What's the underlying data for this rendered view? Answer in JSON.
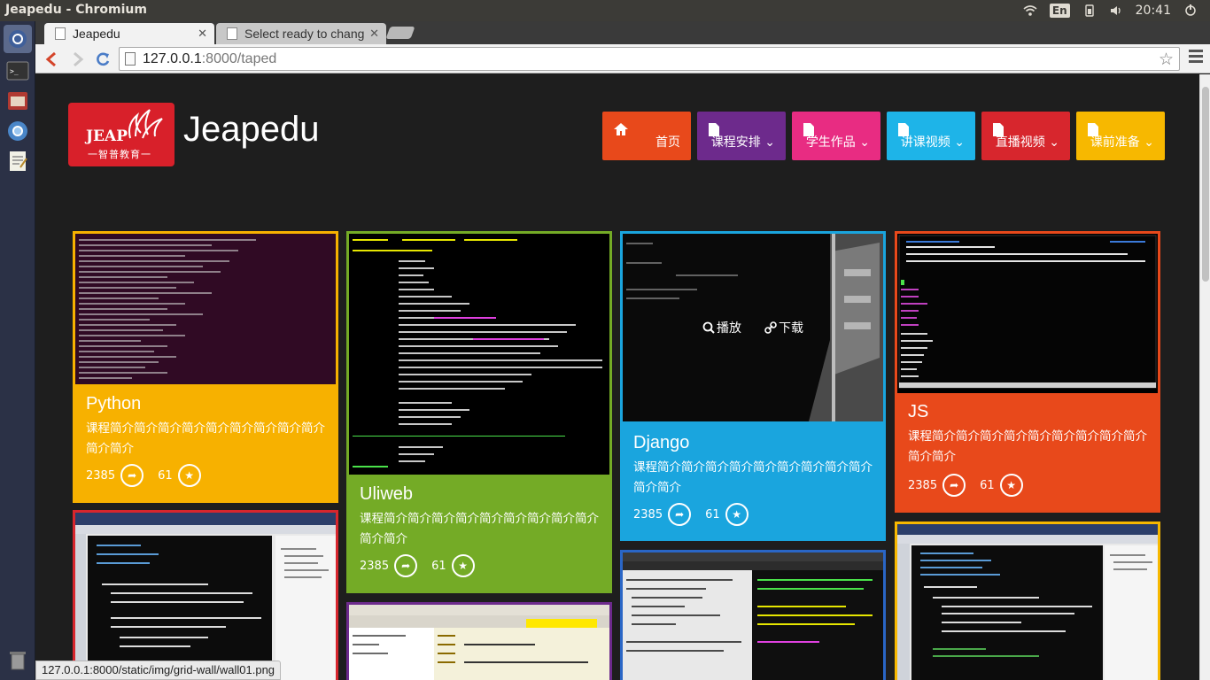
{
  "os": {
    "window_title": "Jeapedu - Chromium",
    "input_method": "En",
    "clock": "20:41"
  },
  "browser": {
    "tabs": [
      {
        "label": "Jeapedu",
        "active": true
      },
      {
        "label": "Select ready to chang",
        "active": false
      }
    ],
    "url_host": "127.0.0.1",
    "url_rest": ":8000/taped",
    "status_url": "127.0.0.1:8000/static/img/grid-wall/wall01.png"
  },
  "site": {
    "logo_main": "JEAP",
    "logo_sub": "一智普教育一",
    "title": "Jeapedu",
    "nav": [
      {
        "label": "首页",
        "color": "#e8491b",
        "icon": "home-icon"
      },
      {
        "label": "课程安排 ⌄",
        "color": "#6d2a8c",
        "icon": "file-icon"
      },
      {
        "label": "学生作品 ⌄",
        "color": "#e82c82",
        "icon": "file-icon"
      },
      {
        "label": "讲课视频 ⌄",
        "color": "#1eb4e8",
        "icon": "file-icon"
      },
      {
        "label": "直播视频 ⌄",
        "color": "#d7262d",
        "icon": "file-icon"
      },
      {
        "label": "课前准备 ⌄",
        "color": "#f7b800",
        "icon": "file-icon"
      }
    ]
  },
  "cards": [
    {
      "name": "Python",
      "desc": "课程简介简介简介简介简介简介简介简介简介简介简介",
      "shares": "2385",
      "likes": "61",
      "color": "#f7b100"
    },
    {
      "name": "Uliweb",
      "desc": "课程简介简介简介简介简介简介简介简介简介简介简介",
      "shares": "2385",
      "likes": "61",
      "color": "#74ab26"
    },
    {
      "name": "Django",
      "desc": "课程简介简介简介简介简介简介简介简介简介简介简介",
      "shares": "2385",
      "likes": "61",
      "color": "#1aa5de"
    },
    {
      "name": "JS",
      "desc": "课程简介简介简介简介简介简介简介简介简介简介简介",
      "shares": "2385",
      "likes": "61",
      "color": "#e8491b"
    }
  ],
  "overlay": {
    "play": "播放",
    "download": "下载"
  }
}
